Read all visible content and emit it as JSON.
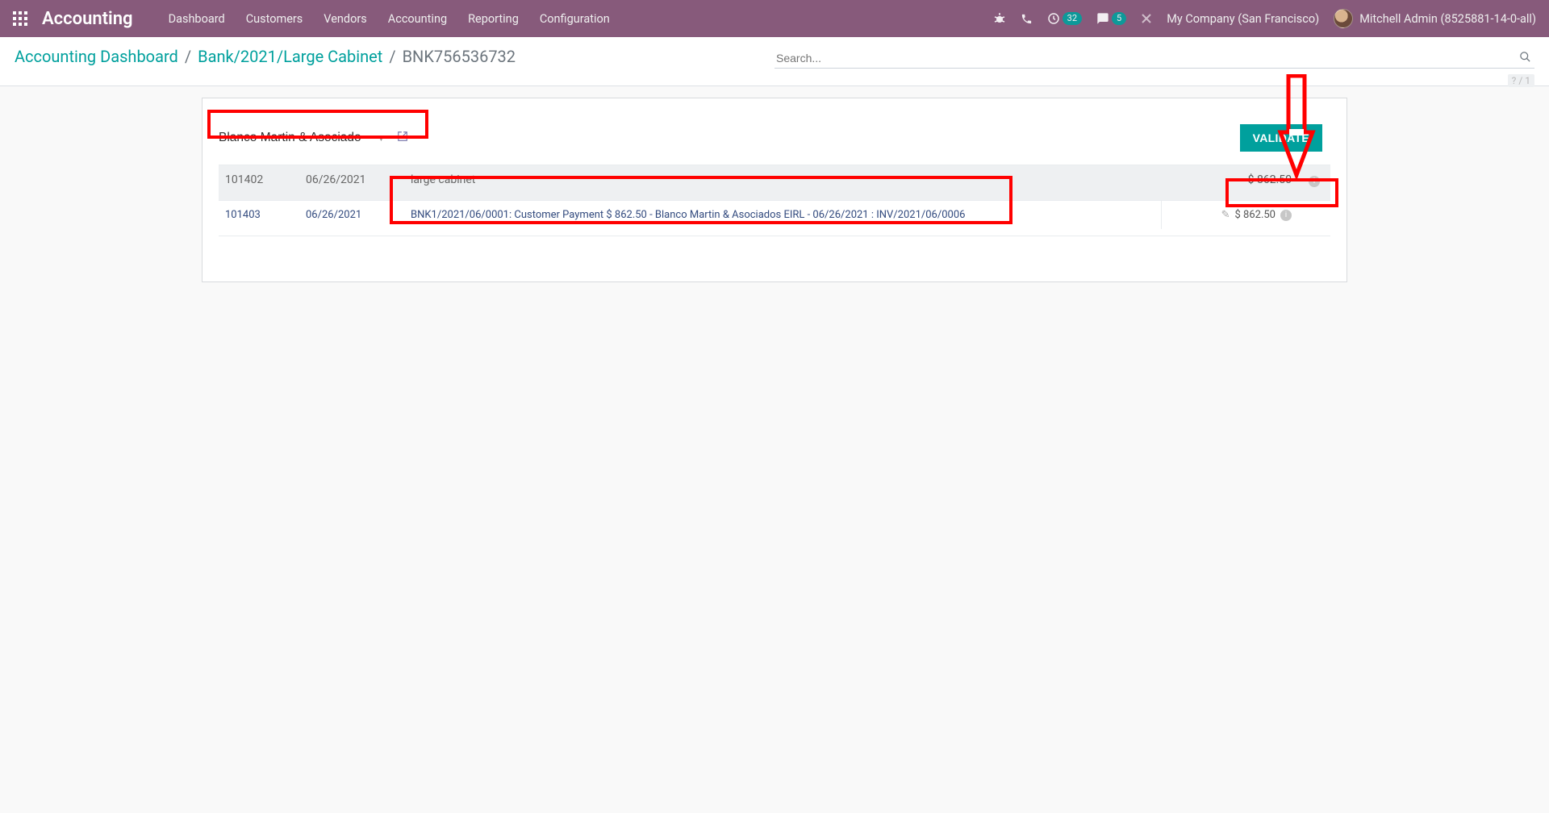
{
  "navbar": {
    "brand": "Accounting",
    "menu": [
      "Dashboard",
      "Customers",
      "Vendors",
      "Accounting",
      "Reporting",
      "Configuration"
    ],
    "clock_badge": "32",
    "chat_badge": "5",
    "company": "My Company (San Francisco)",
    "user": "Mitchell Admin (8525881-14-0-all)"
  },
  "breadcrumb": {
    "items": [
      "Accounting Dashboard",
      "Bank/2021/Large Cabinet"
    ],
    "current": "BNK756536732"
  },
  "search": {
    "placeholder": "Search..."
  },
  "pager": "? / 1",
  "sheet": {
    "partner": "Blanco Martin & Asociado",
    "validate_label": "VALIDATE",
    "header": {
      "id": "101402",
      "date": "06/26/2021",
      "desc": "large cabinet",
      "amount": "$ 862.50"
    },
    "line": {
      "id": "101403",
      "date": "06/26/2021",
      "desc": "BNK1/2021/06/0001: Customer Payment $ 862.50 - Blanco Martin & Asociados EIRL - 06/26/2021 : INV/2021/06/0006",
      "amount": "$ 862.50"
    }
  }
}
